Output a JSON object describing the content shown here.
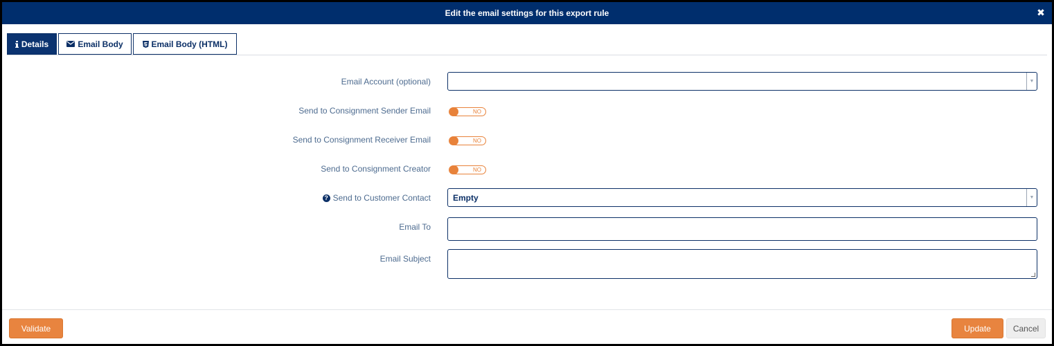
{
  "dialog": {
    "title": "Edit the email settings for this export rule",
    "close_icon": "close-icon"
  },
  "tabs": [
    {
      "label": "Details",
      "icon": "info-icon",
      "active": true
    },
    {
      "label": "Email Body",
      "icon": "envelope-icon",
      "active": false
    },
    {
      "label": "Email Body (HTML)",
      "icon": "html5-icon",
      "active": false
    }
  ],
  "form": {
    "email_account": {
      "label": "Email Account (optional)",
      "value": ""
    },
    "sender_email": {
      "label": "Send to Consignment Sender Email",
      "toggle_text": "NO"
    },
    "receiver_email": {
      "label": "Send to Consignment Receiver Email",
      "toggle_text": "NO"
    },
    "creator": {
      "label": "Send to Consignment Creator",
      "toggle_text": "NO"
    },
    "customer_contact": {
      "label": "Send to Customer Contact",
      "value": "Empty",
      "help_icon": "question-circle-icon"
    },
    "email_to": {
      "label": "Email To",
      "value": ""
    },
    "email_subject": {
      "label": "Email Subject",
      "value": ""
    }
  },
  "footer": {
    "validate_label": "Validate",
    "update_label": "Update",
    "cancel_label": "Cancel"
  },
  "colors": {
    "header_bg": "#002e6d",
    "accent_orange": "#e8843f",
    "label_text": "#4d6b8f"
  }
}
